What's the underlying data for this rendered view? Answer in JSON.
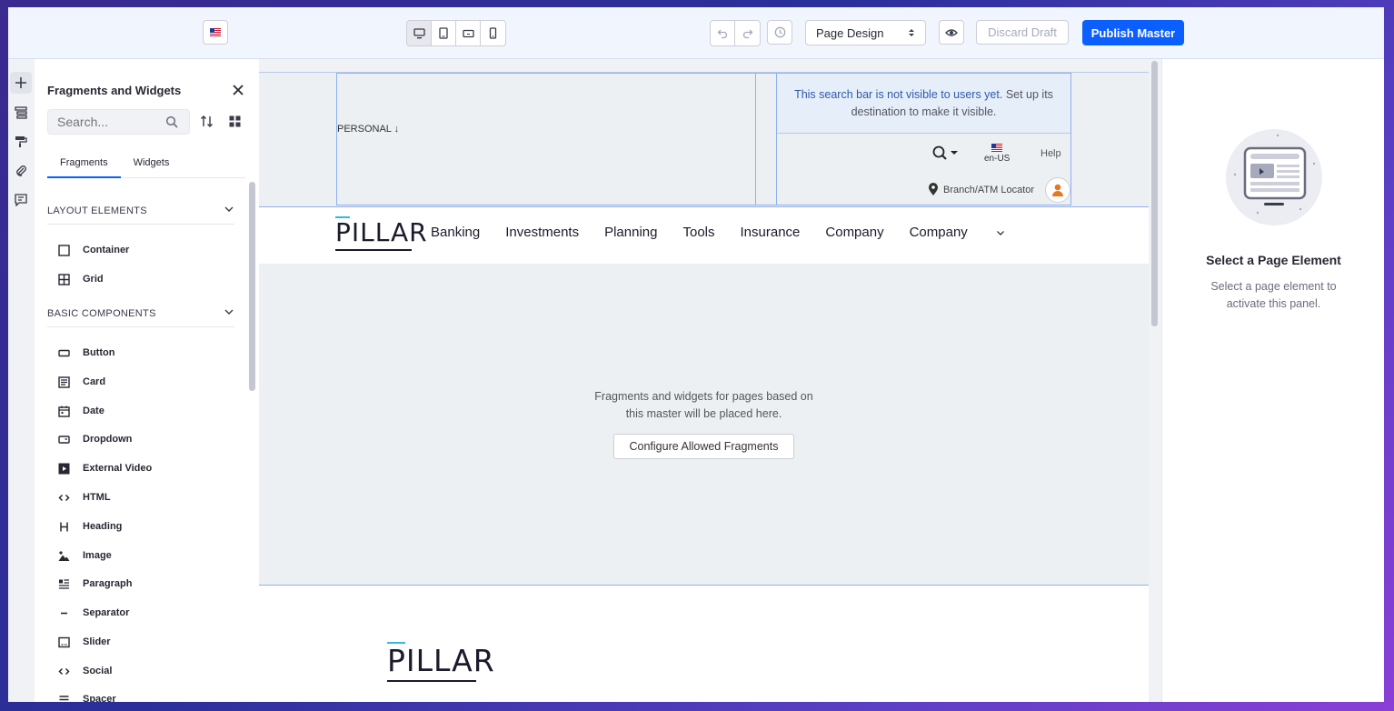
{
  "toolbar": {
    "language_flag": "flag-us-icon",
    "devices": [
      "desktop-icon",
      "tablet-icon",
      "landscape-phone-icon",
      "portrait-phone-icon"
    ],
    "undo_icon": "undo-icon",
    "redo_icon": "redo-icon",
    "history_icon": "history-icon",
    "mode_select": "Page Design",
    "preview_icon": "eye-icon",
    "discard_label": "Discard Draft",
    "publish_label": "Publish Master",
    "accent_color": "#0b5fff"
  },
  "rail": {
    "items": [
      "plus-icon",
      "page-structure-icon",
      "paint-roller-icon",
      "paperclip-icon",
      "comments-icon"
    ]
  },
  "panel": {
    "title": "Fragments and Widgets",
    "search_placeholder": "Search...",
    "tabs": [
      {
        "label": "Fragments",
        "active": true
      },
      {
        "label": "Widgets",
        "active": false
      }
    ],
    "sections": [
      {
        "title": "LAYOUT ELEMENTS",
        "items": [
          {
            "label": "Container",
            "icon": "container-icon"
          },
          {
            "label": "Grid",
            "icon": "grid-icon"
          }
        ]
      },
      {
        "title": "BASIC COMPONENTS",
        "items": [
          {
            "label": "Button",
            "icon": "button-icon"
          },
          {
            "label": "Card",
            "icon": "card-icon"
          },
          {
            "label": "Date",
            "icon": "calendar-icon"
          },
          {
            "label": "Dropdown",
            "icon": "dropdown-icon"
          },
          {
            "label": "External Video",
            "icon": "video-icon"
          },
          {
            "label": "HTML",
            "icon": "code-icon"
          },
          {
            "label": "Heading",
            "icon": "heading-icon"
          },
          {
            "label": "Image",
            "icon": "image-icon"
          },
          {
            "label": "Paragraph",
            "icon": "paragraph-icon"
          },
          {
            "label": "Separator",
            "icon": "separator-icon"
          },
          {
            "label": "Slider",
            "icon": "slider-icon"
          },
          {
            "label": "Social",
            "icon": "code-icon"
          },
          {
            "label": "Spacer",
            "icon": "spacer-icon"
          }
        ]
      }
    ]
  },
  "canvas": {
    "header": {
      "personal_label": "PERSONAL",
      "search_note_main": "This search bar is not visible to users yet.",
      "search_note_rest": "Set up its destination to make it visible.",
      "language": "en-US",
      "help": "Help",
      "locator": "Branch/ATM Locator"
    },
    "nav": {
      "logo": "PILLAR",
      "links": [
        "Banking",
        "Investments",
        "Planning",
        "Tools",
        "Insurance",
        "Company",
        "Company"
      ]
    },
    "drop_zone": {
      "line1": "Fragments and widgets for pages based on",
      "line2": "this master will be placed here.",
      "button": "Configure Allowed Fragments"
    },
    "footer": {
      "logo": "PILLAR"
    }
  },
  "right_panel": {
    "title": "Select a Page Element",
    "description": "Select a page element to activate this panel."
  }
}
